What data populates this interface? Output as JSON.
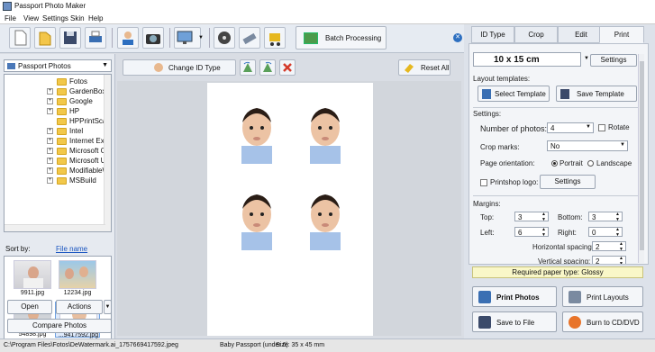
{
  "window": {
    "title": "Passport Photo Maker"
  },
  "menu": [
    "File",
    "View",
    "Settings",
    "Skin",
    "Help"
  ],
  "toolbar": {
    "batch_label": "Batch Processing"
  },
  "left": {
    "folder": "Passport Photos",
    "tree": [
      "Fotos",
      "GardenBox3I",
      "Google",
      "HP",
      "HPPrintScan",
      "Intel",
      "Internet Exp",
      "Microsoft Of",
      "Microsoft Up",
      "ModifiableW",
      "MSBuild"
    ],
    "sort_label": "Sort by:",
    "sort_value": "File name",
    "thumbs": [
      "9911.jpg",
      "12234.jpg",
      "54898.jpg",
      "...9417592.jpg"
    ],
    "open_label": "Open",
    "actions_label": "Actions",
    "compare_label": "Compare Photos"
  },
  "center": {
    "change_id_label": "Change ID Type",
    "reset_label": "Reset All"
  },
  "right": {
    "tabs": [
      "ID Type",
      "Crop",
      "Edit",
      "Print"
    ],
    "paper_size": "10 x 15 cm",
    "settings_label": "Settings",
    "layout_templates": "Layout templates:",
    "select_template": "Select Template",
    "save_template": "Save Template",
    "settings_heading": "Settings:",
    "num_photos_label": "Number of photos:",
    "num_photos_value": "4",
    "rotate_label": "Rotate",
    "crop_marks_label": "Crop marks:",
    "crop_marks_value": "No",
    "orientation_label": "Page orientation:",
    "portrait_label": "Portrait",
    "landscape_label": "Landscape",
    "printshop_label": "Printshop logo:",
    "printshop_settings": "Settings",
    "margins_heading": "Margins:",
    "top_label": "Top:",
    "top_value": "3",
    "bottom_label": "Bottom:",
    "bottom_value": "3",
    "left_label": "Left:",
    "left_value": "6",
    "right_label": "Right:",
    "right_value": "0",
    "hspacing_label": "Horizontal spacing:",
    "hspacing_value": "2",
    "vspacing_label": "Vertical spacing:",
    "vspacing_value": "2",
    "paper_type": "Required paper type: Glossy",
    "print_photos": "Print Photos",
    "print_layouts": "Print Layouts",
    "save_file": "Save to File",
    "burn_cd": "Burn to CD/DVD"
  },
  "status": {
    "path": "C:\\Program Files\\Fotos\\DeWatermark.ai_1757669417592.jpeg",
    "type": "Baby Passport (under 6)",
    "size": "Size: 35 x 45 mm"
  },
  "colors": {
    "accent": "#2d6fc0",
    "folder": "#f2c84a",
    "paper_note": "#f9f7c8"
  }
}
